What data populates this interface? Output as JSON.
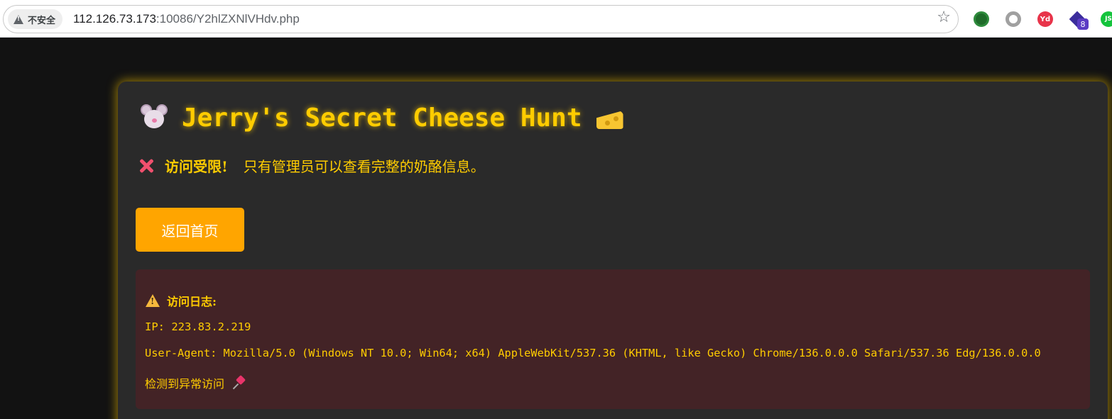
{
  "browser": {
    "security_label": "不安全",
    "url_host": "112.126.73.173",
    "url_path": ":10086/Y2hlZXNlVHdv.php",
    "extensions": [
      {
        "name": "green-circle-extension",
        "label": ""
      },
      {
        "name": "gray-ring-extension",
        "label": ""
      },
      {
        "name": "youdao-extension",
        "label": "Yd"
      },
      {
        "name": "purple-extension",
        "label": "",
        "badge": "8"
      },
      {
        "name": "js-extension",
        "label": "JS"
      }
    ]
  },
  "page": {
    "title": "Jerry's Secret Cheese Hunt",
    "denied_strong": "访问受限!",
    "denied_message": "只有管理员可以查看完整的奶酪信息。",
    "back_button": "返回首页",
    "log": {
      "title": "访问日志:",
      "ip": "IP: 223.83.2.219",
      "user_agent": "User-Agent: Mozilla/5.0 (Windows NT 10.0; Win64; x64) AppleWebKit/537.36 (KHTML, like Gecko) Chrome/136.0.0.0 Safari/537.36 Edg/136.0.0.0",
      "detected": "检测到异常访问"
    }
  },
  "colors": {
    "accent_yellow": "#ffcc00",
    "button_orange": "#ffa500",
    "card_bg": "#2a2a2a",
    "log_bg": "#432326",
    "page_bg": "#121212"
  }
}
